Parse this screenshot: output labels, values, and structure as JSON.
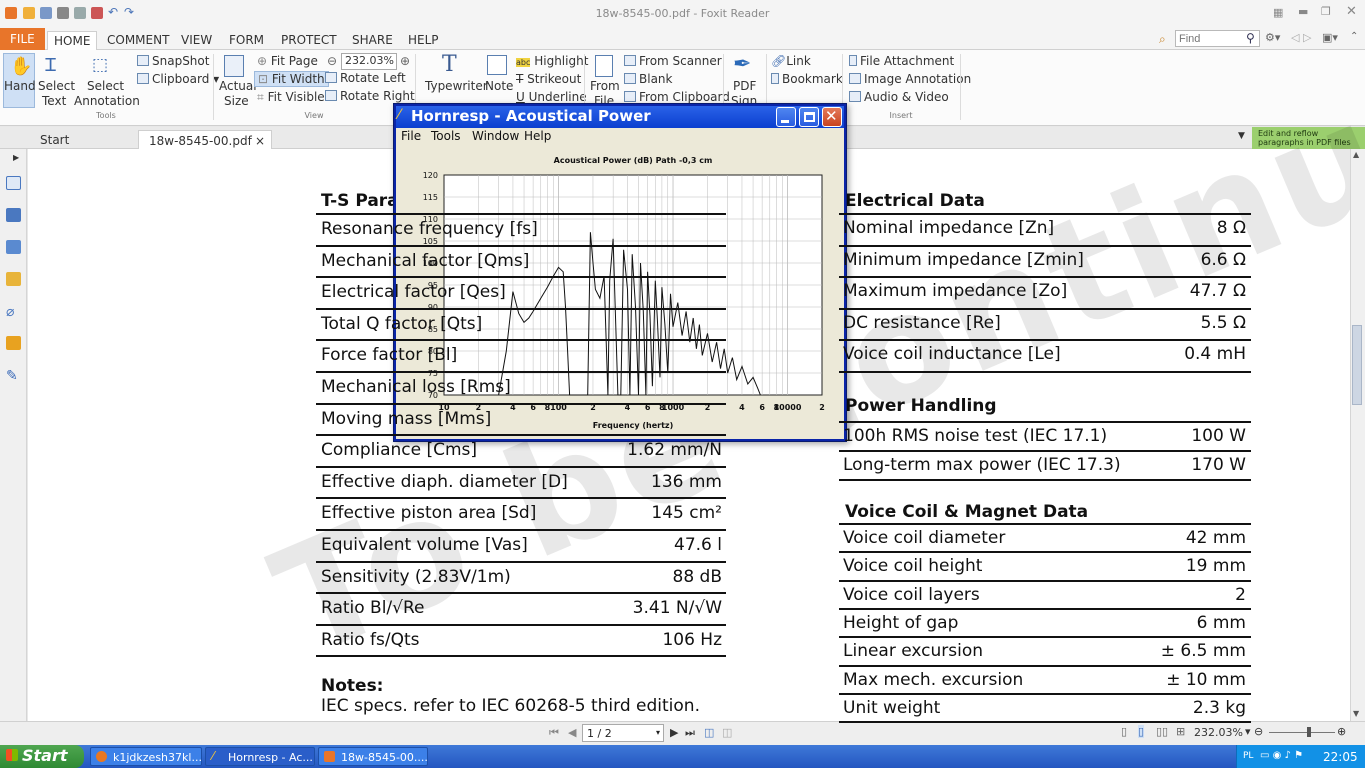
{
  "app": {
    "window_title": "18w-8545-00.pdf - Foxit Reader"
  },
  "menu_tabs": [
    "FILE",
    "HOME",
    "COMMENT",
    "VIEW",
    "FORM",
    "PROTECT",
    "SHARE",
    "HELP"
  ],
  "search": {
    "placeholder": "Find"
  },
  "ribbon": {
    "tools": {
      "hand": "Hand",
      "select_text_1": "Select",
      "select_text_2": "Text",
      "select_annot_1": "Select",
      "select_annot_2": "Annotation",
      "snapshot": "SnapShot",
      "clipboard": "Clipboard",
      "group": "Tools"
    },
    "view": {
      "actual_1": "Actual",
      "actual_2": "Size",
      "fit_page": "Fit Page",
      "fit_width": "Fit Width",
      "fit_visible": "Fit Visible",
      "rotate_left": "Rotate Left",
      "rotate_right": "Rotate Right",
      "zoom_value": "232.03%",
      "group": "View"
    },
    "comment": {
      "typewriter": "Typewriter",
      "note": "Note",
      "highlight": "Highlight",
      "strikeout": "Strikeout",
      "underline": "Underline"
    },
    "create": {
      "from_file_1": "From",
      "from_file_2": "File",
      "from_scanner": "From Scanner",
      "blank": "Blank",
      "from_clipboard": "From Clipboard"
    },
    "sign": {
      "pdf_1": "PDF",
      "pdf_2": "Sign"
    },
    "links": {
      "link": "Link",
      "bookmark": "Bookmark"
    },
    "insert": {
      "file_attachment": "File Attachment",
      "image_annotation": "Image Annotation",
      "audio_video": "Audio & Video",
      "group": "Insert"
    }
  },
  "doc_tabs": {
    "start": "Start",
    "file": "18w-8545-00.pdf",
    "close": "×"
  },
  "reflow_tip": "Edit and reflow paragraphs in PDF files",
  "pdf": {
    "ts_heading": "T-S Parameters",
    "ts_rows": [
      {
        "label": "Resonance frequency [fs]",
        "value": ""
      },
      {
        "label": "Mechanical factor [Qms]",
        "value": ""
      },
      {
        "label": "Electrical factor [Qes]",
        "value": ""
      },
      {
        "label": "Total Q factor [Qts]",
        "value": ""
      },
      {
        "label": "Force factor [Bl]",
        "value": ""
      },
      {
        "label": "Mechanical loss [Rms]",
        "value": ""
      },
      {
        "label": "Moving mass [Mms]",
        "value": ""
      },
      {
        "label": "Compliance [Cms]",
        "value": "1.62 mm/N"
      },
      {
        "label": "Effective diaph. diameter [D]",
        "value": "136 mm"
      },
      {
        "label": "Effective piston area [Sd]",
        "value": "145 cm²"
      },
      {
        "label": "Equivalent volume [Vas]",
        "value": "47.6 l"
      },
      {
        "label": "Sensitivity (2.83V/1m)",
        "value": "88 dB"
      },
      {
        "label": "Ratio Bl/√Re",
        "value": "3.41 N/√W"
      },
      {
        "label": "Ratio fs/Qts",
        "value": "106 Hz"
      }
    ],
    "notes_heading": "Notes:",
    "notes_text": "IEC specs. refer to IEC 60268-5 third edition.",
    "electrical_heading": "Electrical Data",
    "electrical_rows": [
      {
        "label": "Nominal impedance [Zn]",
        "value": "8 Ω"
      },
      {
        "label": "Minimum impedance [Zmin]",
        "value": "6.6 Ω"
      },
      {
        "label": "Maximum impedance [Zo]",
        "value": "47.7 Ω"
      },
      {
        "label": "DC resistance [Re]",
        "value": "5.5 Ω"
      },
      {
        "label": "Voice coil inductance [Le]",
        "value": "0.4 mH"
      }
    ],
    "power_heading": "Power Handling",
    "power_rows": [
      {
        "label": "100h RMS noise test (IEC 17.1)",
        "value": "100 W"
      },
      {
        "label": "Long-term max power (IEC 17.3)",
        "value": "170 W"
      }
    ],
    "vc_heading": "Voice Coil & Magnet Data",
    "vc_rows": [
      {
        "label": "Voice coil diameter",
        "value": "42 mm"
      },
      {
        "label": "Voice coil height",
        "value": "19 mm"
      },
      {
        "label": "Voice coil layers",
        "value": "2"
      },
      {
        "label": "Height of gap",
        "value": "6 mm"
      },
      {
        "label": "Linear excursion",
        "value": "± 6.5 mm"
      },
      {
        "label": "Max mech. excursion",
        "value": "± 10 mm"
      },
      {
        "label": "Unit weight",
        "value": "2.3 kg"
      }
    ],
    "watermark": "To be continued"
  },
  "statusbar": {
    "page": "1 / 2",
    "zoom": "232.03%"
  },
  "taskbar": {
    "start": "Start",
    "tasks": [
      "k1jdkzesh37kl...",
      "Hornresp - Ac...",
      "18w-8545-00...."
    ],
    "clock": "22:05",
    "lang": "PL"
  },
  "dialog": {
    "title": "Hornresp - Acoustical Power",
    "menu": [
      "File",
      "Tools",
      "Window",
      "Help"
    ]
  },
  "chart_data": {
    "type": "line",
    "title": "Acoustical Power (dB)   Path -0,3 cm",
    "xlabel": "Frequency (hertz)",
    "ylabel": "",
    "x_scale": "log",
    "xlim": [
      10,
      20000
    ],
    "ylim": [
      70,
      120
    ],
    "y_ticks": [
      70,
      75,
      80,
      85,
      90,
      95,
      100,
      105,
      110,
      115,
      120
    ],
    "x_tick_labels": [
      "10",
      "2",
      "4",
      "6",
      "8",
      "100",
      "2",
      "4",
      "6",
      "8",
      "1000",
      "2",
      "4",
      "6",
      "8",
      "10000",
      "2"
    ],
    "grid": true,
    "series": [
      {
        "x": [
          30,
          35,
          40,
          45,
          50,
          55,
          60,
          70,
          80,
          90,
          100,
          110,
          115,
          120,
          125,
          130,
          150,
          160,
          170,
          180,
          190,
          200,
          210,
          230,
          250,
          270,
          280,
          300,
          330,
          350,
          370,
          400,
          420,
          440,
          470,
          500,
          520,
          550,
          580,
          600,
          630,
          660,
          700,
          730,
          770,
          800,
          850,
          900,
          950,
          1000,
          1100,
          1200,
          1300,
          1400,
          1500,
          1600,
          1700,
          1800,
          2000,
          2200,
          2400,
          2600,
          2800,
          3000,
          3300,
          3600,
          4000,
          4500,
          5000,
          5500,
          5800
        ],
        "y": [
          70,
          80,
          93.5,
          88.5,
          86.5,
          87.5,
          89,
          92,
          94.5,
          97,
          99,
          98,
          90,
          80,
          70,
          70,
          70,
          70,
          70,
          70,
          107,
          100,
          94,
          92,
          97,
          70,
          96,
          105.5,
          70,
          70,
          103,
          94,
          70,
          102,
          90,
          70,
          100,
          89,
          70,
          98,
          88,
          72,
          96,
          87,
          74,
          94.5,
          86,
          75,
          93,
          85.5,
          91,
          83.5,
          89,
          82,
          87.5,
          80.5,
          86,
          79,
          84,
          77.5,
          82,
          76,
          80.5,
          75,
          78.5,
          73.5,
          76.5,
          72.5,
          74,
          71.5,
          70
        ]
      }
    ]
  },
  "colors": {
    "accent": "#e8752a",
    "title_blue": "#0b3fcf",
    "taskbar": "#2456c0"
  }
}
